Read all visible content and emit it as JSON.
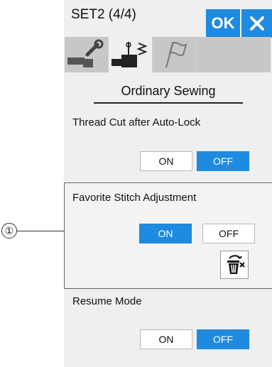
{
  "header": {
    "title": "SET2 (4/4)",
    "ok_label": "OK"
  },
  "icons": {
    "close": "close-icon",
    "wrench": "wrench-icon",
    "sewing": "sewing-machine-icon",
    "flag": "flag-icon",
    "trash": "trash-icon"
  },
  "section": {
    "title": "Ordinary Sewing"
  },
  "settings": {
    "thread_cut": {
      "label": "Thread Cut after Auto-Lock",
      "on": "ON",
      "off": "OFF",
      "selected": "OFF"
    },
    "favorite": {
      "label": "Favorite Stitch Adjustment",
      "on": "ON",
      "off": "OFF",
      "selected": "ON"
    },
    "resume": {
      "label": "Resume Mode",
      "on": "ON",
      "off": "OFF",
      "selected": "OFF"
    }
  },
  "callout": {
    "number": "①"
  },
  "colors": {
    "accent": "#1e8ae0",
    "panel": "#efefef"
  }
}
